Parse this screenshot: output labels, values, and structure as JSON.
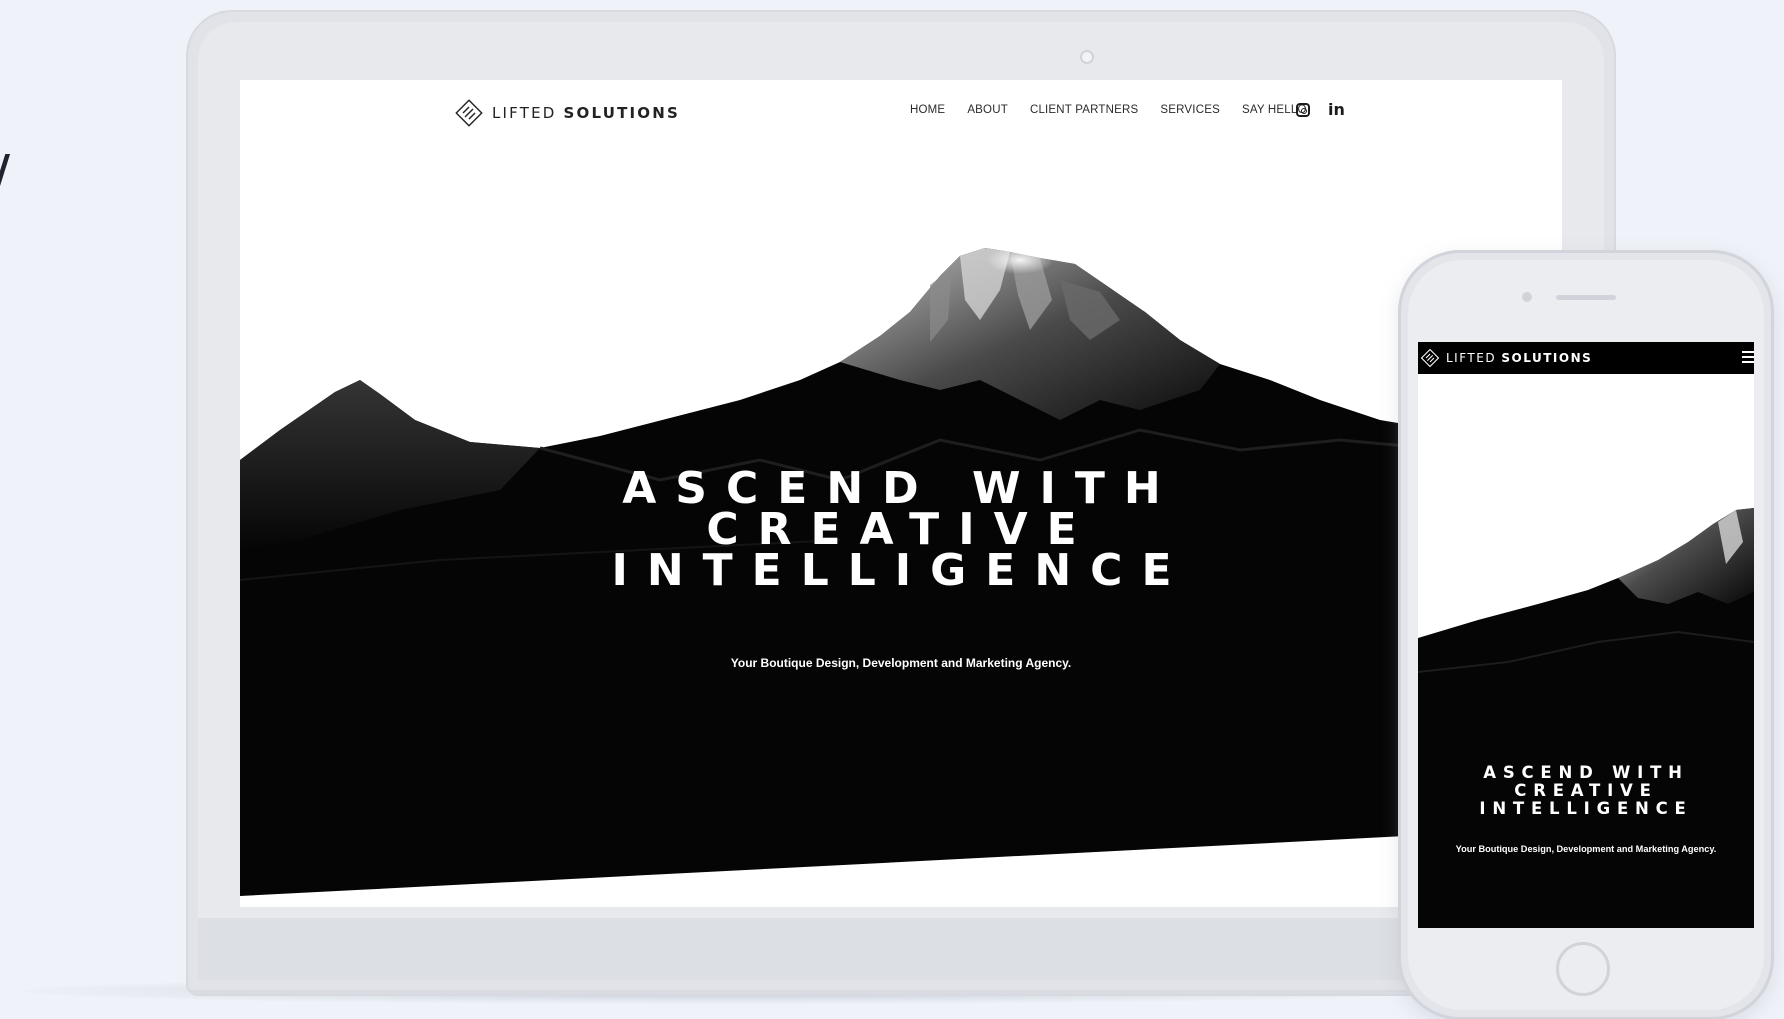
{
  "desktop": {
    "logo": {
      "light": "LIFTED",
      "bold": "SOLUTIONS"
    },
    "nav": [
      "HOME",
      "ABOUT",
      "CLIENT PARTNERS",
      "SERVICES",
      "SAY HELLO"
    ],
    "social": {
      "instagram": "instagram-icon",
      "linkedin": "in"
    },
    "hero": {
      "title_line1": "ASCEND WITH",
      "title_line2": "CREATIVE",
      "title_line3": "INTELLIGENCE",
      "subtitle": "Your Boutique Design, Development and Marketing Agency."
    }
  },
  "mobile": {
    "logo": {
      "light": "LIFTED",
      "bold": "SOLUTIONS"
    },
    "menu_icon": "hamburger-icon",
    "hero": {
      "title_line1": "ASCEND WITH",
      "title_line2": "CREATIVE",
      "title_line3": "INTELLIGENCE",
      "subtitle": "Your Boutique Design, Development and Marketing Agency."
    }
  },
  "colors": {
    "background": "#eff2f8",
    "device_frame": "#e1e3e8",
    "hero_dark": "#000000",
    "text_light": "#ffffff"
  }
}
